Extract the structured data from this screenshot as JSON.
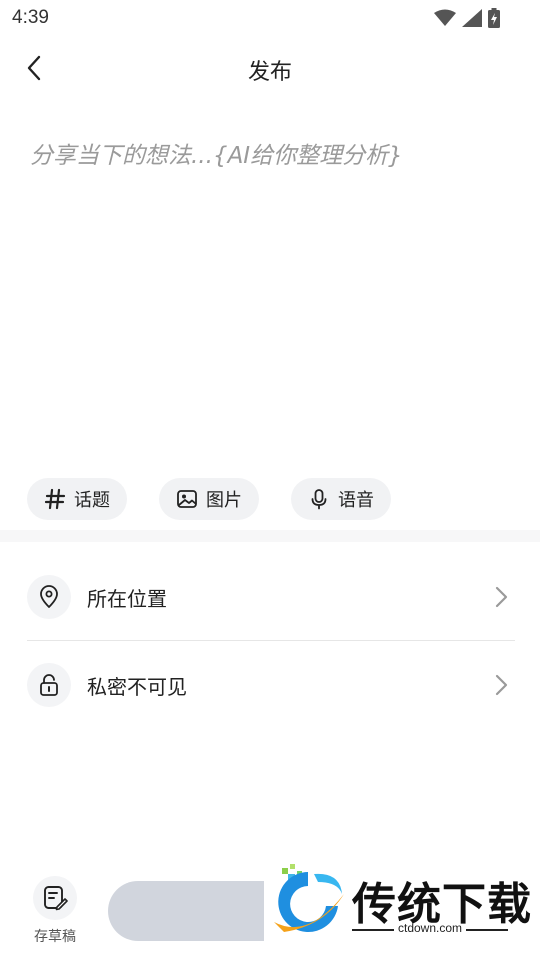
{
  "status_bar": {
    "time": "4:39"
  },
  "nav": {
    "title": "发布"
  },
  "post": {
    "placeholder": "分享当下的想法...{AI给你整理分析}"
  },
  "chips": [
    {
      "label": "话题",
      "icon": "hashtag-icon"
    },
    {
      "label": "图片",
      "icon": "image-icon"
    },
    {
      "label": "语音",
      "icon": "microphone-icon"
    }
  ],
  "settings": [
    {
      "label": "所在位置",
      "icon": "location-pin-icon"
    },
    {
      "label": "私密不可见",
      "icon": "unlock-icon"
    }
  ],
  "bottom": {
    "draft_label": "存草稿"
  },
  "watermark": {
    "name": "传统下载",
    "url": "ctdown.com"
  }
}
